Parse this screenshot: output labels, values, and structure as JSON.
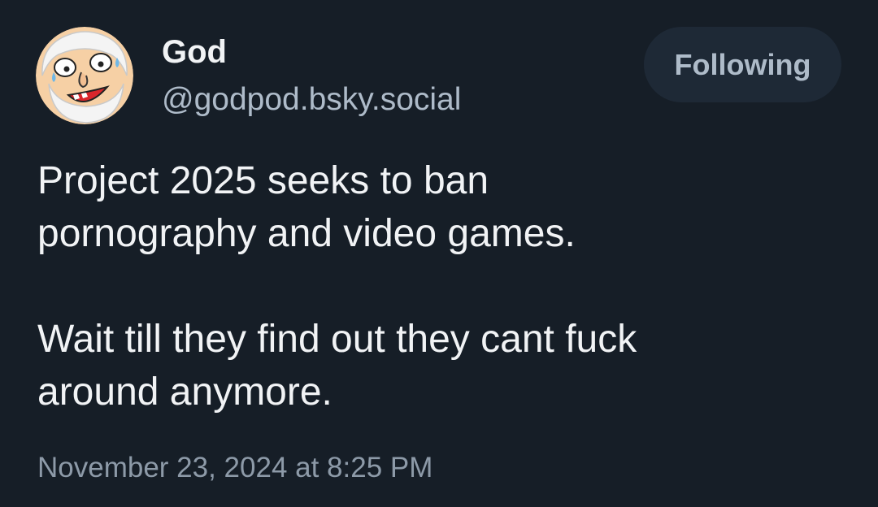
{
  "post": {
    "author": {
      "display_name": "God",
      "handle": "@godpod.bsky.social",
      "avatar_icon": "bearded-god-cartoon-avatar"
    },
    "follow_button_label": "Following",
    "body": [
      "Project 2025 seeks to ban\npornography and video games.",
      "Wait till they find out they cant fuck\naround anymore."
    ],
    "timestamp": "November 23, 2024 at 8:25 PM"
  },
  "colors": {
    "background": "#161e27",
    "primary_text": "#f1f3f5",
    "secondary_text": "#aebbc9",
    "button_background": "#1e2936"
  }
}
